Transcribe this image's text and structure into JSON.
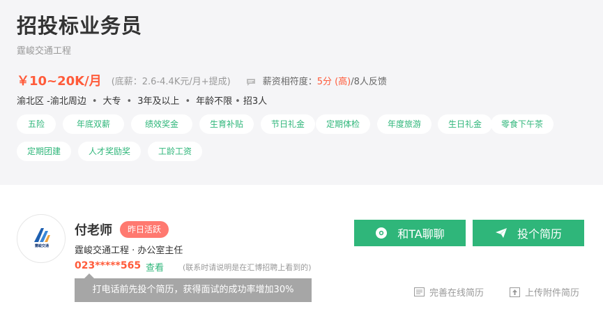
{
  "job": {
    "title": "招投标业务员",
    "company": "霆峻交通工程",
    "salary": "￥10~20K/月",
    "salary_detail": "(底薪：2.6-4.4K元/月+提成)",
    "match_label": "薪资相符度：",
    "match_score": "5分 (高)",
    "feedback": "/8人反馈",
    "district": "渝北区 -渝北周边",
    "education": "大专",
    "experience": "3年及以上",
    "age": "年龄不限",
    "headcount": "招3人",
    "separator": "•"
  },
  "benefits": [
    "五险",
    "年底双薪",
    "绩效奖金",
    "生育补贴",
    "节日礼金",
    "定期体检",
    "年度旅游",
    "生日礼金",
    "零食下午茶",
    "定期团建",
    "人才奖励奖",
    "工龄工资"
  ],
  "contact": {
    "name": "付老师",
    "active_badge": "昨日活跃",
    "company_line": "霆峻交通工程 · 办公室主任",
    "phone": "023*****565",
    "view_label": "查看",
    "phone_note": "(联系时请说明是在汇博招聘上看到的)",
    "tip": "打电话前先投个简历，获得面试的成功率增加30%",
    "avatar_text": "霆峻交通"
  },
  "actions": {
    "chat_label": "和TA聊聊",
    "apply_label": "投个简历",
    "online_resume_label": "完善在线简历",
    "upload_resume_label": "上传附件简历"
  },
  "colors": {
    "accent": "#2fb67a",
    "salary": "#ff5b3a",
    "badge": "#ff7970",
    "top_bg": "#f5f5f7"
  },
  "icons": {
    "match": "message-icon",
    "chat": "chat-bubble-icon",
    "apply": "paper-plane-icon",
    "online_resume": "resume-doc-icon",
    "upload_resume": "upload-icon"
  }
}
